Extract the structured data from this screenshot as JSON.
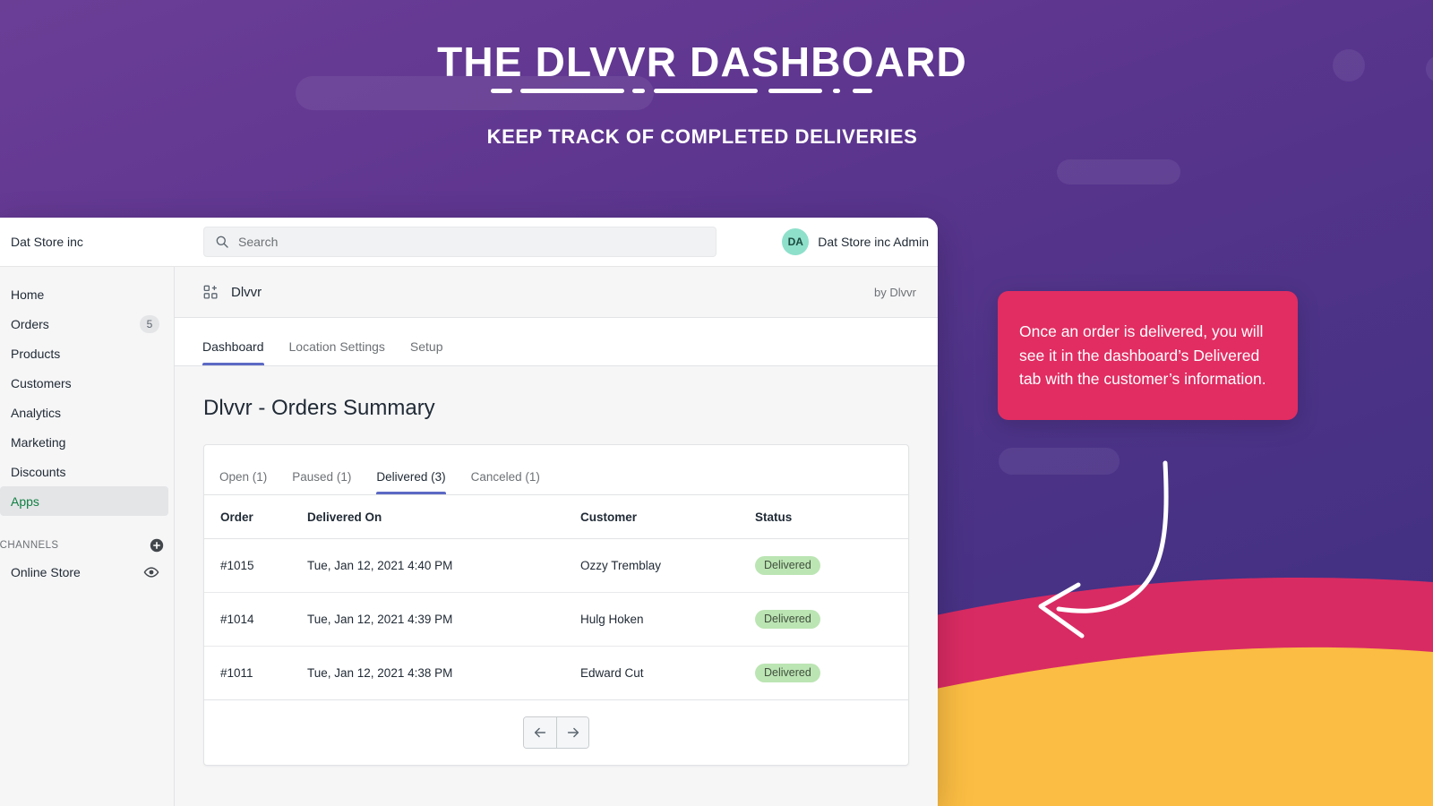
{
  "promo": {
    "title": "THE DLVVR DASHBOARD",
    "subtitle": "KEEP TRACK OF COMPLETED DELIVERIES",
    "callout": "Once an order is delivered, you will see it in the dashboard’s Delivered tab with the customer’s information."
  },
  "colors": {
    "bg_purple_light": "#6b3e96",
    "bg_purple_dark": "#3c2f80",
    "callout_pink": "#e12d62",
    "wave_crimson": "#d92b63",
    "wave_yellow": "#fbbd43",
    "wave_navy": "#342b7d",
    "accent_indigo": "#5c6ac4",
    "status_green_bg": "#bbe5b3",
    "status_green_text": "#414f3e",
    "active_nav_green": "#108043",
    "avatar_teal": "#8ee0cb"
  },
  "topbar": {
    "store_name": "Dat Store inc",
    "search_placeholder": "Search",
    "search_value": "",
    "avatar_initials": "DA",
    "user_name": "Dat Store inc Admin"
  },
  "sidebar": {
    "items": [
      {
        "label": "Home",
        "badge": "",
        "active": false
      },
      {
        "label": "Orders",
        "badge": "5",
        "active": false
      },
      {
        "label": "Products",
        "badge": "",
        "active": false
      },
      {
        "label": "Customers",
        "badge": "",
        "active": false
      },
      {
        "label": "Analytics",
        "badge": "",
        "active": false
      },
      {
        "label": "Marketing",
        "badge": "",
        "active": false
      },
      {
        "label": "Discounts",
        "badge": "",
        "active": false
      },
      {
        "label": "Apps",
        "badge": "",
        "active": true
      }
    ],
    "section_label": "S CHANNELS",
    "channels": [
      {
        "label": "Online Store"
      }
    ]
  },
  "app": {
    "icon_name": "apps-grid-icon",
    "title": "Dlvvr",
    "by": "by Dlvvr",
    "tabs": [
      {
        "label": "Dashboard",
        "active": true
      },
      {
        "label": "Location Settings",
        "active": false
      },
      {
        "label": "Setup",
        "active": false
      }
    ]
  },
  "main": {
    "page_title": "Dlvvr - Orders Summary",
    "card_tabs": [
      {
        "label": "Open (1)",
        "active": false
      },
      {
        "label": "Paused (1)",
        "active": false
      },
      {
        "label": "Delivered (3)",
        "active": true
      },
      {
        "label": "Canceled (1)",
        "active": false
      }
    ],
    "table": {
      "columns": [
        "Order",
        "Delivered On",
        "Customer",
        "Status"
      ],
      "rows": [
        {
          "order": "#1015",
          "delivered_on": "Tue, Jan 12, 2021 4:40 PM",
          "customer": "Ozzy Tremblay",
          "status": "Delivered"
        },
        {
          "order": "#1014",
          "delivered_on": "Tue, Jan 12, 2021 4:39 PM",
          "customer": "Hulg Hoken",
          "status": "Delivered"
        },
        {
          "order": "#1011",
          "delivered_on": "Tue, Jan 12, 2021 4:38 PM",
          "customer": "Edward Cut",
          "status": "Delivered"
        }
      ]
    },
    "pager": {
      "prev_icon": "arrow-left-icon",
      "next_icon": "arrow-right-icon"
    }
  }
}
